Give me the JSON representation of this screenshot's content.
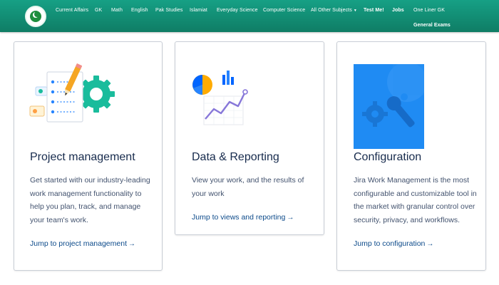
{
  "nav": {
    "items": [
      {
        "label": "Current Affairs"
      },
      {
        "label": "GK"
      },
      {
        "label": "Math"
      },
      {
        "label": "English"
      },
      {
        "label": "Pak Studies"
      },
      {
        "label": "Islamiat"
      },
      {
        "label": "Everyday Science"
      },
      {
        "label": "Computer Science"
      },
      {
        "label": "All Other Subjects"
      },
      {
        "label": "Test Me!"
      },
      {
        "label": "Jobs"
      },
      {
        "label": "One Liner GK"
      },
      {
        "label": "General Exams"
      }
    ]
  },
  "cards": [
    {
      "title": "Project management",
      "lines": [
        "Get started with our industry-leading",
        "work management functionality to",
        "help you plan, track, and manage",
        "your team's work."
      ],
      "link": "Jump to project management",
      "icon": "checklist-pencil-gear-illustration"
    },
    {
      "title": "Data & Reporting",
      "lines": [
        "View your work, and the results of",
        "your work"
      ],
      "link": "Jump to views and reporting",
      "icon": "pie-bar-line-chart-illustration"
    },
    {
      "title": "Configuration",
      "lines": [
        "Jira Work Management is the most",
        "configurable and customizable tool in",
        "the market with granular control over",
        "security, privacy, and workflows."
      ],
      "link": "Jump to configuration",
      "icon": "gear-wrench-illustration"
    }
  ],
  "arrow_glyph": "→",
  "colors": {
    "nav_bg": "#128a70",
    "title": "#172b4d",
    "body_text": "#42526e",
    "link": "#0c4a8a",
    "config_blue": "#1f8bf3"
  }
}
